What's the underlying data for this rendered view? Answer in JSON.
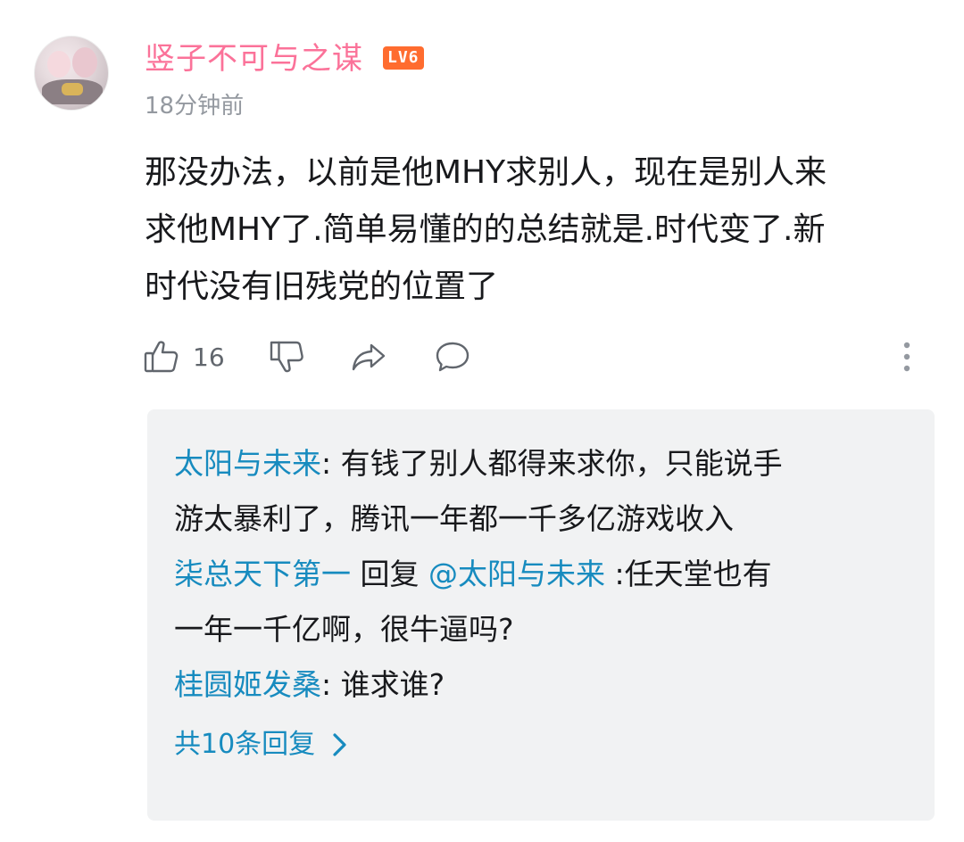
{
  "comment": {
    "username": "竖子不可与之谋",
    "level": "LV6",
    "time": "18分钟前",
    "text_line1": "那没办法，以前是他MHY求别人，现在是别人来",
    "text_line2": "求他MHY了.简单易懂的的总结就是.时代变了.新",
    "text_line3": "时代没有旧残党的位置了",
    "like_count": "16"
  },
  "replies": [
    {
      "name": "太阳与未来",
      "sep": ": ",
      "text_line1": "有钱了别人都得来求你，只能说手",
      "text_line2": "游太暴利了，腾讯一年都一千多亿游戏收入"
    },
    {
      "name": "柒总天下第一",
      "reply_word": " 回复 ",
      "at": "@太阳与未来",
      "sep": " :",
      "text_line1": "任天堂也有",
      "text_line2": "一年一千亿啊，很牛逼吗?"
    },
    {
      "name": "桂圆姬发桑",
      "sep": ": ",
      "text_line1": "谁求谁?"
    }
  ],
  "more_replies_label": "共10条回复",
  "icons": {
    "like": "thumbs-up-icon",
    "dislike": "thumbs-down-icon",
    "share": "share-icon",
    "reply": "comment-bubble-icon",
    "more": "more-vertical-icon",
    "chevron": "chevron-right-icon"
  },
  "colors": {
    "username": "#fb7299",
    "level_badge": "#ff6c2f",
    "link": "#178bbf",
    "meta": "#9499a0",
    "reply_bg": "#f1f2f3"
  }
}
